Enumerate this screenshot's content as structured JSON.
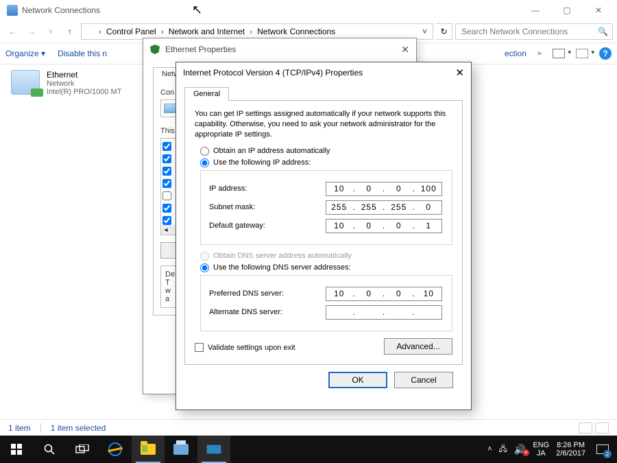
{
  "window": {
    "title": "Network Connections",
    "min": "—",
    "max": "▢",
    "close": "✕"
  },
  "nav": {
    "back": "←",
    "fwd": "→",
    "up": "↑",
    "breadcrumb": [
      "Control Panel",
      "Network and Internet",
      "Network Connections"
    ],
    "sep": "›",
    "dropdown": "˅",
    "refresh": "↻",
    "search_placeholder": "Search Network Connections",
    "search_icon": "🔍"
  },
  "cmdbar": {
    "organize": "Organize ▾",
    "disable": "Disable this n",
    "ection": "ection",
    "chev": "»"
  },
  "adapter": {
    "name": "Ethernet",
    "type": "Network",
    "device": "Intel(R) PRO/1000 MT"
  },
  "statusbar": {
    "count": "1 item",
    "selected": "1 item selected"
  },
  "ethprops": {
    "title": "Ethernet Properties",
    "tab": "Netwo",
    "connect_label": "Con",
    "this_label": "This",
    "list_checks": [
      true,
      true,
      true,
      true,
      false,
      true,
      true
    ],
    "desc_head": "De",
    "desc_lines": [
      "T",
      "w",
      "a"
    ]
  },
  "ipv4": {
    "title": "Internet Protocol Version 4 (TCP/IPv4) Properties",
    "close": "✕",
    "tab": "General",
    "intro": "You can get IP settings assigned automatically if your network supports this capability. Otherwise, you need to ask your network administrator for the appropriate IP settings.",
    "r_obtain_ip": "Obtain an IP address automatically",
    "r_use_ip": "Use the following IP address:",
    "ip_label": "IP address:",
    "ip": [
      "10",
      "0",
      "0",
      "100"
    ],
    "mask_label": "Subnet mask:",
    "mask": [
      "255",
      "255",
      "255",
      "0"
    ],
    "gw_label": "Default gateway:",
    "gw": [
      "10",
      "0",
      "0",
      "1"
    ],
    "r_obtain_dns": "Obtain DNS server address automatically",
    "r_use_dns": "Use the following DNS server addresses:",
    "pdns_label": "Preferred DNS server:",
    "pdns": [
      "10",
      "0",
      "0",
      "10"
    ],
    "adns_label": "Alternate DNS server:",
    "adns": [
      "",
      "",
      "",
      ""
    ],
    "validate": "Validate settings upon exit",
    "advanced": "Advanced...",
    "ok": "OK",
    "cancel": "Cancel"
  },
  "taskbar": {
    "lang1": "ENG",
    "lang2": "JA",
    "time": "8:26 PM",
    "date": "2/6/2017",
    "notif_count": "2",
    "chevron": "˄"
  }
}
